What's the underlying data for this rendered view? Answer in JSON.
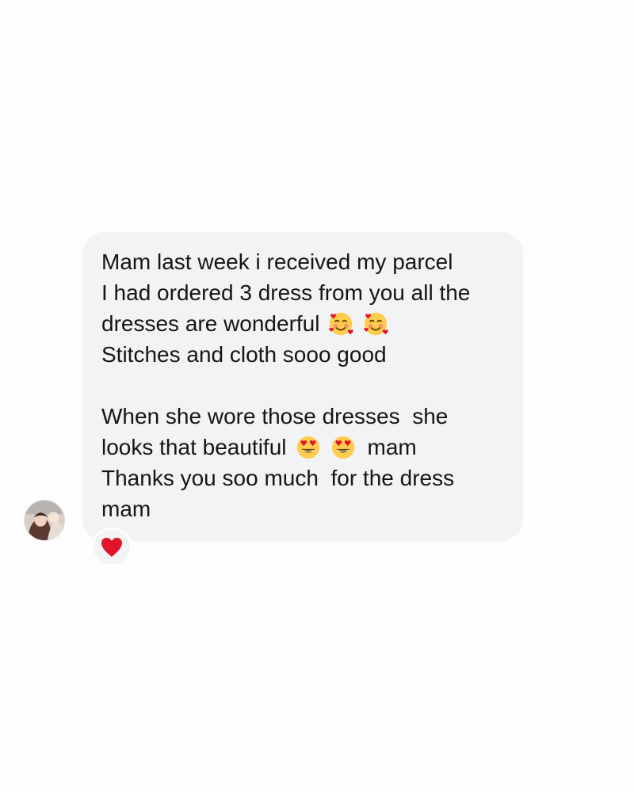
{
  "message": {
    "line1": "Mam last week i received my parcel",
    "line2": "I had ordered 3 dress from you all the",
    "line3": "dresses are wonderful",
    "line3_emojis": [
      "smiling-face-with-hearts",
      "smiling-face-with-hearts"
    ],
    "line4": "Stitches and cloth sooo good",
    "line5": "When she wore those dresses  she",
    "line6_start": "looks that beautiful",
    "line6_emojis": [
      "heart-eyes",
      "heart-eyes"
    ],
    "line6_end": "mam",
    "line7": "Thanks you soo much  for the dress",
    "line8": "mam"
  },
  "reaction": {
    "icon": "red-heart",
    "color": "#e0142b"
  },
  "avatar": {
    "icon": "profile-avatar"
  },
  "colors": {
    "background": "#fdfdfd",
    "bubble": "#f2f3f5",
    "text": "#151515"
  }
}
